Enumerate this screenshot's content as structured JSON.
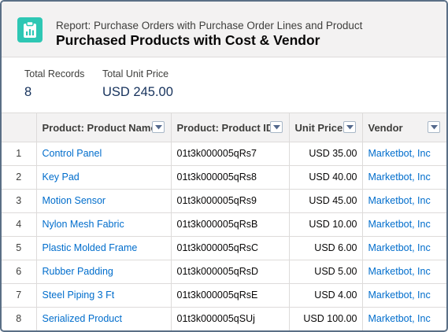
{
  "header": {
    "eyebrow": "Report: Purchase Orders with Purchase Order Lines and Product",
    "title": "Purchased Products with Cost & Vendor",
    "icon": "report-clipboard-icon",
    "icon_color": "#2ec7b4"
  },
  "summary": {
    "total_records_label": "Total Records",
    "total_records_value": "8",
    "total_price_label": "Total Unit Price",
    "total_price_value": "USD 245.00"
  },
  "table": {
    "columns": [
      "Product: Product Name",
      "Product: Product ID",
      "Unit Price",
      "Vendor"
    ],
    "rows": [
      {
        "n": "1",
        "name": "Control Panel",
        "id": "01t3k000005qRs7",
        "price": "USD 35.00",
        "vendor": "Marketbot, Inc"
      },
      {
        "n": "2",
        "name": "Key Pad",
        "id": "01t3k000005qRs8",
        "price": "USD 40.00",
        "vendor": "Marketbot, Inc"
      },
      {
        "n": "3",
        "name": "Motion Sensor",
        "id": "01t3k000005qRs9",
        "price": "USD 45.00",
        "vendor": "Marketbot, Inc"
      },
      {
        "n": "4",
        "name": "Nylon Mesh Fabric",
        "id": "01t3k000005qRsB",
        "price": "USD 10.00",
        "vendor": "Marketbot, Inc"
      },
      {
        "n": "5",
        "name": "Plastic Molded Frame",
        "id": "01t3k000005qRsC",
        "price": "USD 6.00",
        "vendor": "Marketbot, Inc"
      },
      {
        "n": "6",
        "name": "Rubber Padding",
        "id": "01t3k000005qRsD",
        "price": "USD 5.00",
        "vendor": "Marketbot, Inc"
      },
      {
        "n": "7",
        "name": "Steel Piping 3 Ft",
        "id": "01t3k000005qRsE",
        "price": "USD 4.00",
        "vendor": "Marketbot, Inc"
      },
      {
        "n": "8",
        "name": "Serialized Product",
        "id": "01t3k000005qSUj",
        "price": "USD 100.00",
        "vendor": "Marketbot, Inc"
      }
    ]
  }
}
